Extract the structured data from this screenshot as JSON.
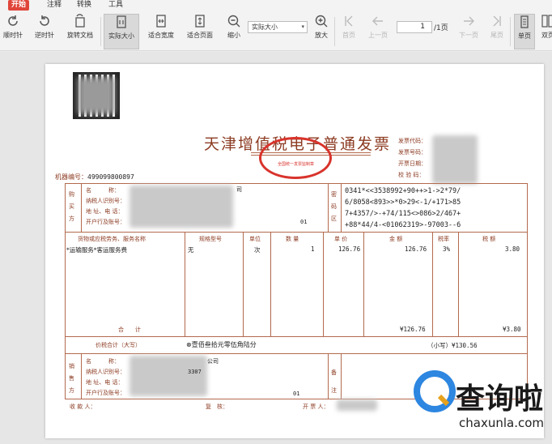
{
  "menu": {
    "items": [
      "开始",
      "注释",
      "转换",
      "工具"
    ]
  },
  "toolbar": {
    "buttons": {
      "rotate_cw": "顺时针",
      "rotate_ccw": "逆时针",
      "rotate_doc": "旋转文档",
      "actual_size": "实际大小",
      "fit_width": "适合宽度",
      "fit_page": "适合页面",
      "zoom_out": "缩小",
      "zoom_in": "放大",
      "first_page": "首页",
      "prev_page": "上一页",
      "next_page": "下一页",
      "last_page": "尾页",
      "single_page": "单页",
      "double_page": "双页"
    },
    "zoom_value": "实际大小",
    "page_current": "1",
    "page_total": "/1页"
  },
  "invoice": {
    "title": "天津增值税电子普通发票",
    "seal_text": "全国统一发票监制章",
    "machine_no_label": "机器编号：",
    "machine_no": "499099800897",
    "header_fields": [
      "发票代码：",
      "发票号码：",
      "开票日期：",
      "校 验 码："
    ],
    "buyer_label": "购买方",
    "buyer_fields": [
      "名　　　称：",
      "纳税人识别号：",
      "地 址、电 话：",
      "开户行及账号："
    ],
    "buyer_name_suffix": "司",
    "buyer_account_suffix": "01",
    "password_label": "密码区",
    "password_lines": [
      "0341*<<3538992+90++>1->2*79/",
      "6/8058<893>>*0>29<-1/+171>85",
      "7+4357/>-+74/115<>086>2/467+",
      "+88*44/4-<01062319>-97003--6"
    ],
    "columns": [
      "货物或应税劳务、服务名称",
      "规格型号",
      "单位",
      "数 量",
      "单 价",
      "金 额",
      "税率",
      "税 额"
    ],
    "item": {
      "name": "*运输服务*客运服务费",
      "spec": "无",
      "unit": "次",
      "qty": "1",
      "price": "126.76",
      "amount": "126.76",
      "rate": "3%",
      "tax": "3.80"
    },
    "total_label": "合　　计",
    "total_amount": "¥126.76",
    "total_tax": "¥3.80",
    "grand_label": "价税合计（大写）",
    "grand_words": "⊗壹佰叁拾元零伍角陆分",
    "grand_small": "（小写）¥130.56",
    "seller_label": "销售方",
    "seller_fields": [
      "名　　　称：",
      "纳税人识别号：",
      "地 址、电 话：",
      "开户行及账号："
    ],
    "seller_name_suffix": "公司",
    "seller_tax_suffix": "3307",
    "seller_account_suffix": "01",
    "remark_label": "备注",
    "footer": [
      "收 款 人：",
      "复　核：",
      "开 票 人："
    ]
  },
  "watermark": {
    "title": "查询啦",
    "url": "chaxunla.com"
  },
  "colors": {
    "accent": "#e0453a",
    "invoice": "#8c3b22",
    "seal": "#d8332c",
    "brand_blue": "#2d86e0"
  }
}
